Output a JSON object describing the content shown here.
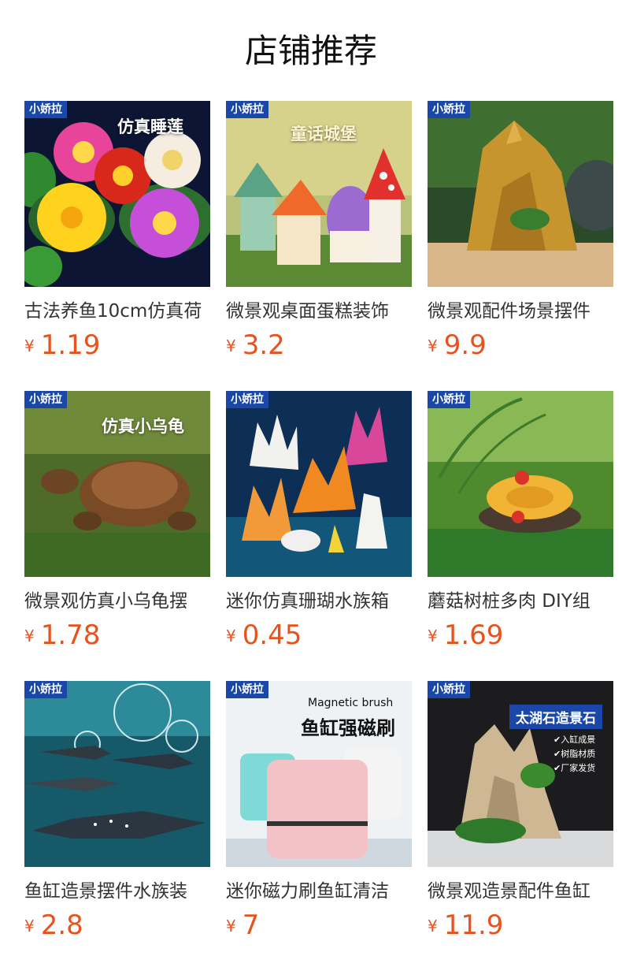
{
  "page_title": "店铺推荐",
  "currency_symbol": "¥",
  "products": [
    {
      "brand": "小娇拉",
      "overlay": "仿真睡莲",
      "name": "古法养鱼10cm仿真荷",
      "price": "1.19",
      "image": "lotus-flowers"
    },
    {
      "brand": "小娇拉",
      "overlay": "童话城堡",
      "name": "微景观桌面蛋糕装饰",
      "price": "3.2",
      "image": "mushroom-houses"
    },
    {
      "brand": "小娇拉",
      "overlay": "",
      "name": "微景观配件场景摆件",
      "price": "9.9",
      "image": "rock-castle"
    },
    {
      "brand": "小娇拉",
      "overlay": "仿真小乌龟",
      "name": "微景观仿真小乌龟摆",
      "price": "1.78",
      "image": "turtle"
    },
    {
      "brand": "小娇拉",
      "overlay": "",
      "name": "迷你仿真珊瑚水族箱",
      "price": "0.45",
      "image": "corals"
    },
    {
      "brand": "小娇拉",
      "overlay": "",
      "name": "蘑菇树桩多肉 DIY组",
      "price": "1.69",
      "image": "mushroom-stump"
    },
    {
      "brand": "小娇拉",
      "overlay": "",
      "name": "鱼缸造景摆件水族装",
      "price": "2.8",
      "image": "sharks"
    },
    {
      "brand": "小娇拉",
      "overlay": "Magnetic brush|鱼缸强磁刷",
      "name": "迷你磁力刷鱼缸清洁",
      "price": "7",
      "image": "magnetic-brush"
    },
    {
      "brand": "小娇拉",
      "overlay": "太湖石造景石|入缸成景|树脂材质|厂家发货",
      "name": "微景观造景配件鱼缸",
      "price": "11.9",
      "image": "taihu-stone"
    }
  ]
}
